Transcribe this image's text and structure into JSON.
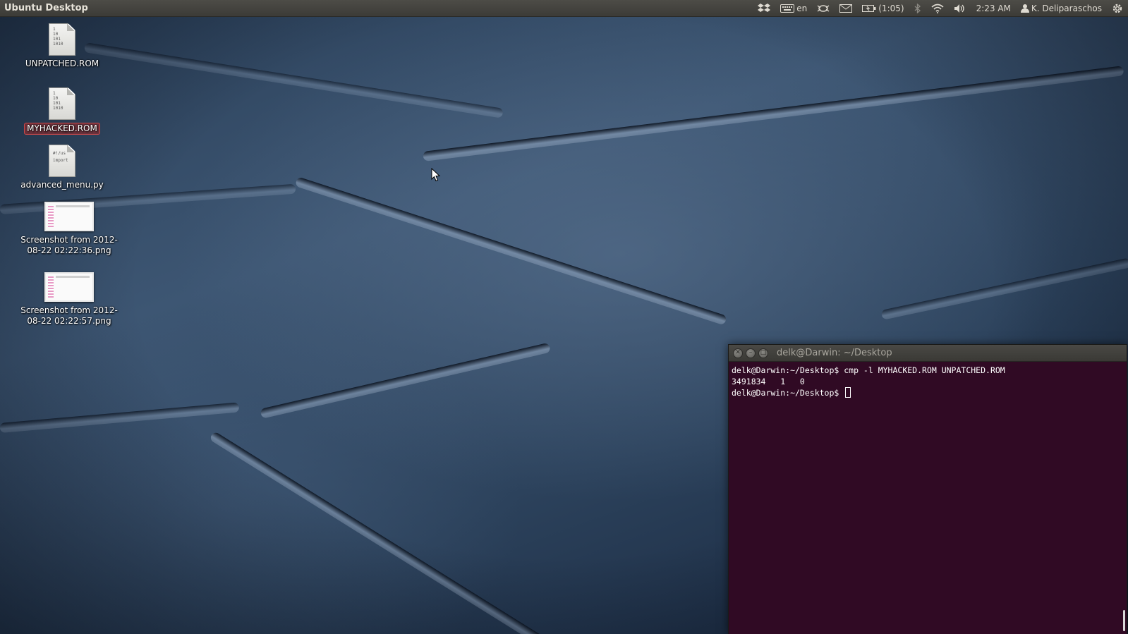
{
  "panel": {
    "title": "Ubuntu Desktop",
    "keyboard_layout": "en",
    "battery": "(1:05)",
    "clock": "2:23 AM",
    "user": "K. Deliparaschos"
  },
  "desktop": {
    "icons": [
      {
        "label": "UNPATCHED.ROM",
        "type": "binary-file",
        "selected": false
      },
      {
        "label": "MYHACKED.ROM",
        "type": "binary-file",
        "selected": true
      },
      {
        "label": "advanced_menu.py",
        "type": "script-file",
        "selected": false
      },
      {
        "label_line1": "Screenshot from 2012-",
        "label_line2": "08-22 02:22:36.png",
        "type": "image-file",
        "selected": false
      },
      {
        "label_line1": "Screenshot from 2012-",
        "label_line2": "08-22 02:22:57.png",
        "type": "image-file",
        "selected": false
      }
    ],
    "binary_glyph": [
      "1",
      "10",
      "101",
      "1010"
    ],
    "script_glyph": [
      "#!/us",
      "import"
    ]
  },
  "terminal": {
    "title": "delk@Darwin: ~/Desktop",
    "lines": [
      "delk@Darwin:~/Desktop$ cmp -l MYHACKED.ROM UNPATCHED.ROM",
      "3491834   1   0",
      "delk@Darwin:~/Desktop$ "
    ],
    "colors": {
      "background": "#300a24",
      "foreground": "#ffffff"
    }
  },
  "colors": {
    "panel": "#3c3b37",
    "selection": "#d04a4a"
  }
}
